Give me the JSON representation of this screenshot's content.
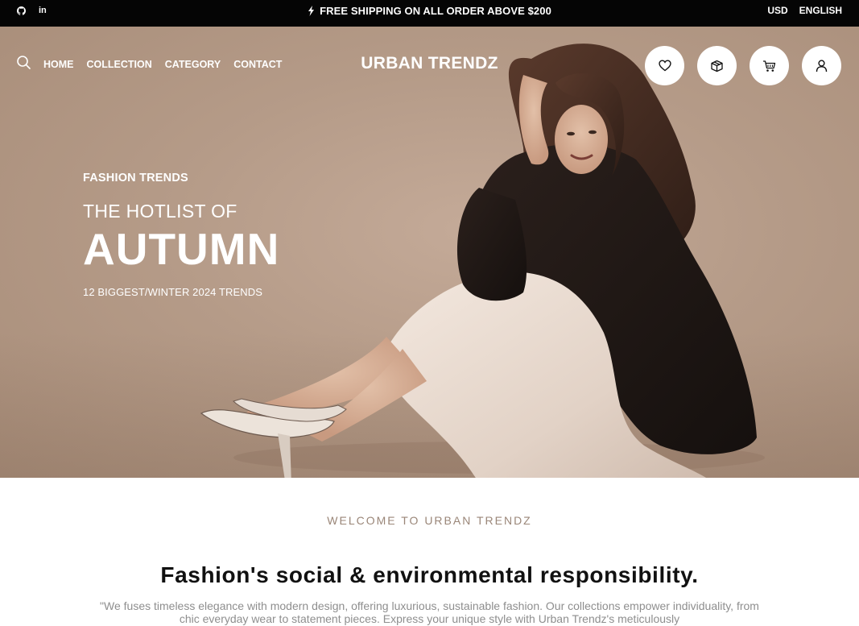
{
  "topbar": {
    "social": [
      {
        "name": "github-icon"
      },
      {
        "name": "linkedin-icon",
        "label": "in"
      }
    ],
    "shipping_text": "FREE SHIPPING ON ALL ORDER ABOVE $200",
    "currency": "USD",
    "language": "ENGLISH"
  },
  "nav": {
    "links": [
      "HOME",
      "COLLECTION",
      "CATEGORY",
      "CONTACT"
    ],
    "brand": "URBAN TRENDZ",
    "icons": [
      "heart-icon",
      "box-icon",
      "cart-icon",
      "user-icon"
    ]
  },
  "hero": {
    "eyebrow": "FASHION TRENDS",
    "line1": "THE HOTLIST OF",
    "line2": "AUTUMN",
    "line3": "12 BIGGEST/WINTER 2024 TRENDS"
  },
  "welcome": {
    "kicker": "WELCOME TO URBAN TRENDZ",
    "heading": "Fashion's social & environmental responsibility.",
    "body": "\"We fuses timeless elegance with modern design, offering luxurious, sustainable fashion. Our collections empower individuality, from chic everyday wear to statement pieces. Express your unique style with Urban Trendz's meticulously"
  },
  "colors": {
    "topbar_bg": "#050505",
    "hero_bg": "#b59b88",
    "kicker": "#9a8678",
    "body_text": "#8e8e8e"
  }
}
